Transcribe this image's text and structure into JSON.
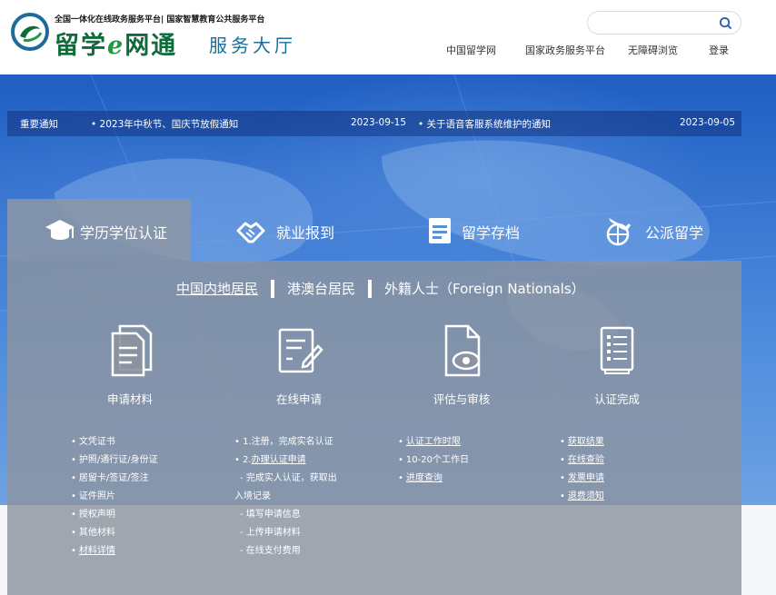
{
  "header": {
    "logo_tagline": "全国一体化在线政务服务平台| 国家智慧教育公共服务平台",
    "logo_title": "留学",
    "logo_title_e": "e",
    "logo_title_tail": "网通",
    "logo_subtitle": "服务大厅",
    "search_placeholder": "",
    "nav": [
      "中国留学网",
      "国家政务服务平台",
      "无障碍浏览",
      "登录"
    ]
  },
  "notice": {
    "label": "重要通知",
    "items": [
      {
        "text": "• 2023年中秋节、国庆节放假通知",
        "date": "2023-09-15"
      },
      {
        "text": "• 关于语音客服系统维护的通知",
        "date": "2023-09-05"
      }
    ]
  },
  "tabs": [
    {
      "label": "学历学位认证",
      "icon": "graduation-cap-icon",
      "active": true
    },
    {
      "label": "就业报到",
      "icon": "handshake-icon",
      "active": false
    },
    {
      "label": "留学存档",
      "icon": "archive-icon",
      "active": false
    },
    {
      "label": "公派留学",
      "icon": "airplane-globe-icon",
      "active": false
    }
  ],
  "residency": [
    {
      "label": "中国内地居民",
      "active": true
    },
    {
      "label": "港澳台居民",
      "active": false
    },
    {
      "label": "外籍人士（Foreign Nationals）",
      "active": false
    }
  ],
  "steps": [
    {
      "label": "申请材料",
      "icon": "documents-icon"
    },
    {
      "label": "在线申请",
      "icon": "online-form-icon"
    },
    {
      "label": "评估与审核",
      "icon": "review-eye-icon"
    },
    {
      "label": "认证完成",
      "icon": "certificate-list-icon"
    }
  ],
  "lists": {
    "materials": [
      "文凭证书",
      "护照/通行证/身份证",
      "居留卡/签证/签注",
      "证件照片",
      "授权声明",
      "其他材料",
      "材料详情"
    ],
    "apply": [
      "• 1.注册，完成实名认证",
      "• 2.",
      "办理认证申请",
      "- 完成实人认证，获取出",
      "入境记录",
      "- 填写申请信息",
      "- 上传申请材料",
      "- 在线支付费用"
    ],
    "review": [
      "认证工作时限",
      "10-20个工作日",
      "进度查询"
    ],
    "done": [
      "获取结果",
      "在线查验",
      "发票申请",
      "退费须知"
    ]
  },
  "colors": {
    "brand_green": "#0f6b3b",
    "brand_blue": "#1b6c98",
    "hero_blue": "#3b79d3",
    "panel_gray": "#8c94a0"
  }
}
